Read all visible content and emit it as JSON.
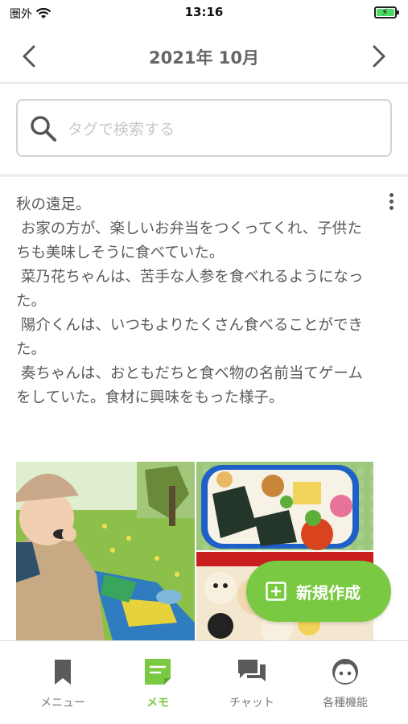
{
  "status_bar": {
    "carrier": "圏外",
    "time": "13:16",
    "battery_level": 0.9
  },
  "nav": {
    "title": "2021年 10月",
    "prev_icon": "chevron-left-icon",
    "next_icon": "chevron-right-icon"
  },
  "search": {
    "placeholder": "タグで検索する",
    "value": ""
  },
  "memo": {
    "text": "秋の遠足。\n お家の方が、楽しいお弁当をつくってくれ、子供たちも美味しそうに食べていた。\n 菜乃花ちゃんは、苦手な人参を食べれるようになった。\n 陽介くんは、いつもよりたくさん食べることができた。\n 奏ちゃんは、おともだちと食べ物の名前当てゲームをしていた。食材に興味をもった様子。"
  },
  "fab": {
    "label": "新規作成",
    "icon": "plus-square-icon"
  },
  "tabs": [
    {
      "label": "メニュー",
      "icon": "bookmark-icon",
      "active": false
    },
    {
      "label": "メモ",
      "icon": "memo-icon",
      "active": true
    },
    {
      "label": "チャット",
      "icon": "chat-icon",
      "active": false
    },
    {
      "label": "各種機能",
      "icon": "face-icon",
      "active": false
    }
  ],
  "colors": {
    "accent": "#7ac943",
    "text": "#5a5a5a",
    "tab_inactive": "#777777"
  }
}
